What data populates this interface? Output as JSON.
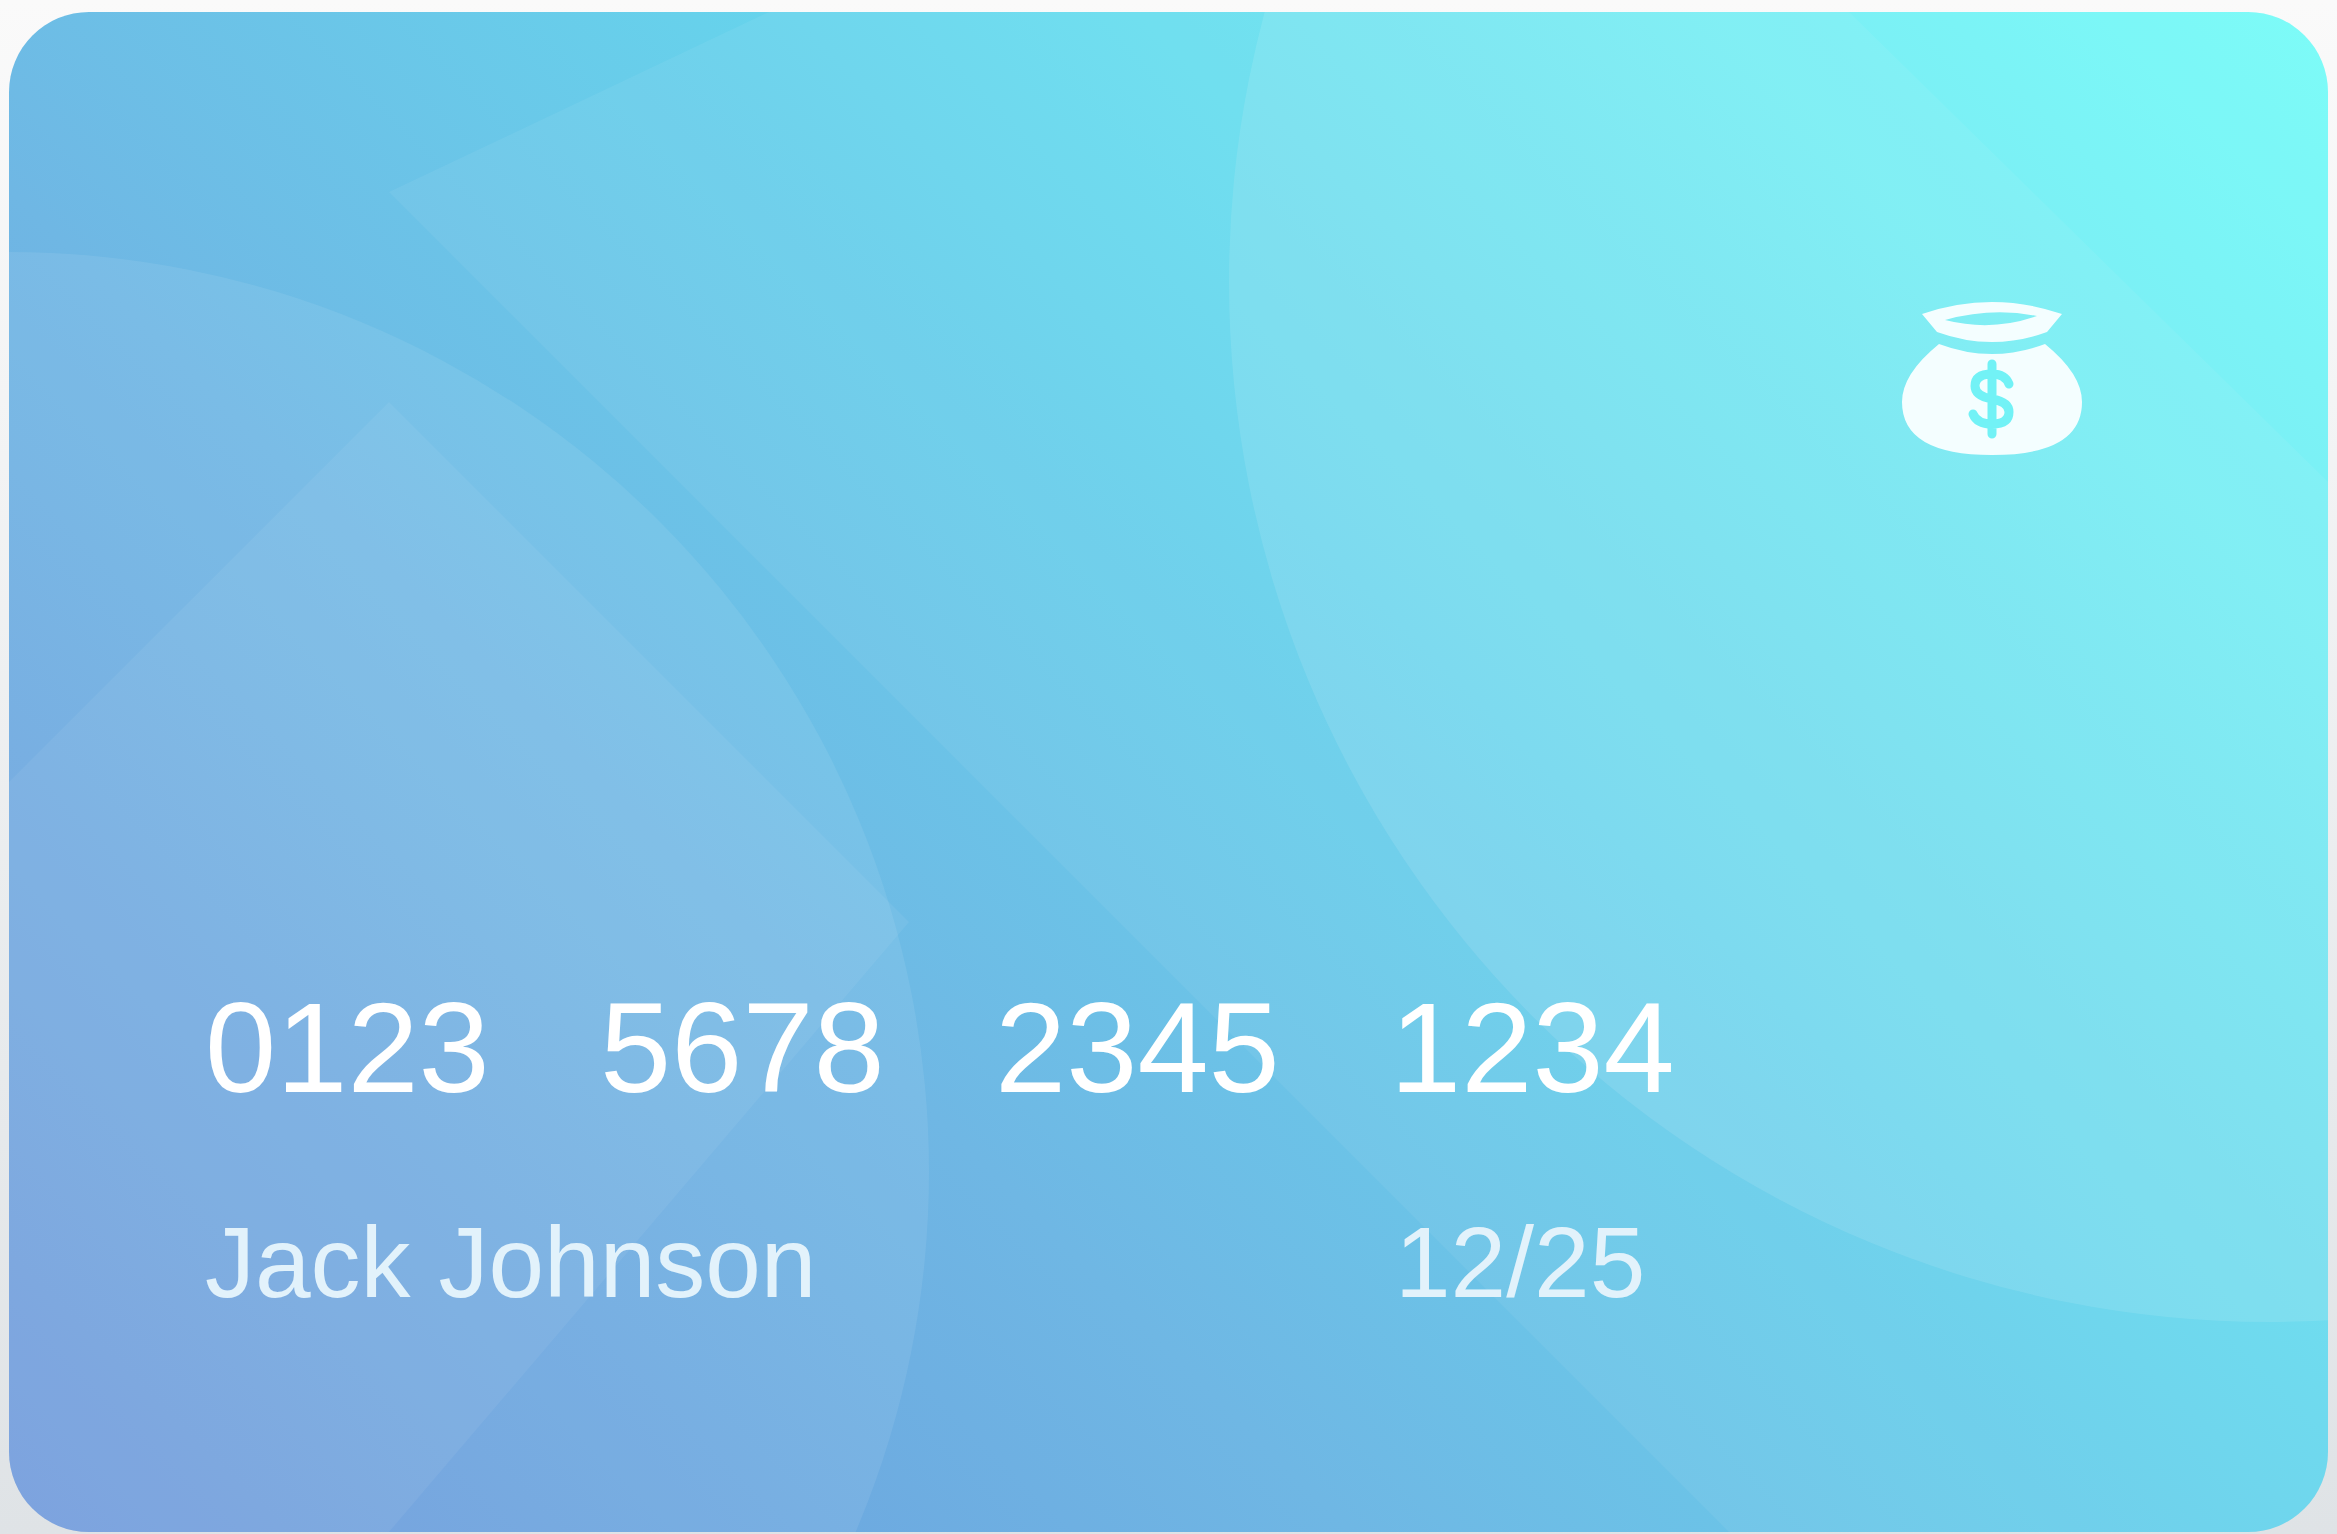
{
  "card": {
    "number_groups": [
      "0123",
      "5678",
      "2345",
      "1234"
    ],
    "holder_name": "Jack Johnson",
    "expiry": "12/25"
  }
}
